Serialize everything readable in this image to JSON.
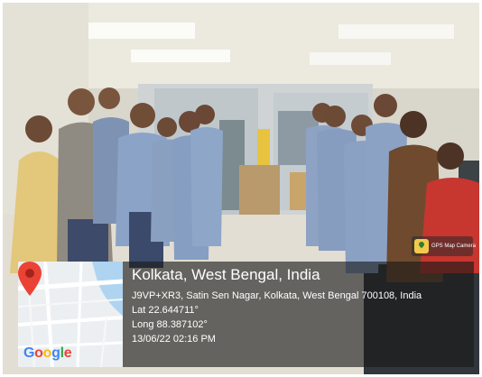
{
  "overlay": {
    "app_badge": "GPS Map Camera",
    "location_title": "Kolkata, West Bengal, India",
    "address": "J9VP+XR3, Satin Sen Nagar, Kolkata, West Bengal 700108, India",
    "latitude": "Lat 22.644711°",
    "longitude": "Long 88.387102°",
    "datetime": "13/06/22 02:16 PM",
    "map_logo": "Google",
    "map_pin_color": "#ea4335"
  },
  "icons": {
    "badge": "map-camera-icon",
    "pin": "location-pin-icon"
  }
}
